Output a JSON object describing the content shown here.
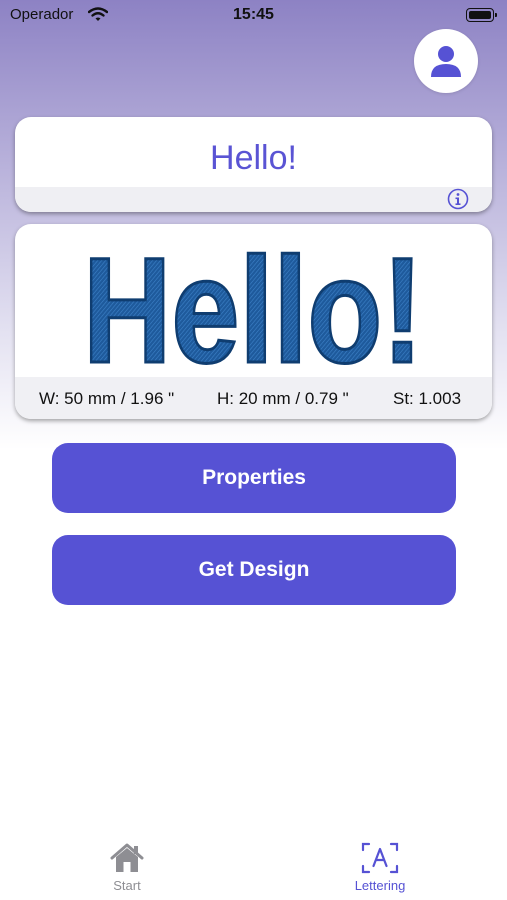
{
  "status_bar": {
    "carrier": "Operador",
    "time": "15:45"
  },
  "header": {
    "avatar_icon": "person-icon"
  },
  "lettering": {
    "text": "Hello!",
    "info_icon": "info-icon"
  },
  "preview": {
    "design_text": "Hello!",
    "width": "W: 50 mm / 1.96 \"",
    "height": "H: 20 mm / 0.79 \"",
    "stitches": "St: 1.003"
  },
  "actions": {
    "properties_label": "Properties",
    "get_design_label": "Get Design"
  },
  "tabs": [
    {
      "label": "Start",
      "icon": "house-icon",
      "selected": false
    },
    {
      "label": "Lettering",
      "icon": "lettering-icon",
      "selected": true
    }
  ],
  "colors": {
    "accent": "#5652d4",
    "text_accent": "#5a54d4",
    "embroidery_blue": "#1e5a9c",
    "gradient_top": "#8d82c4"
  }
}
